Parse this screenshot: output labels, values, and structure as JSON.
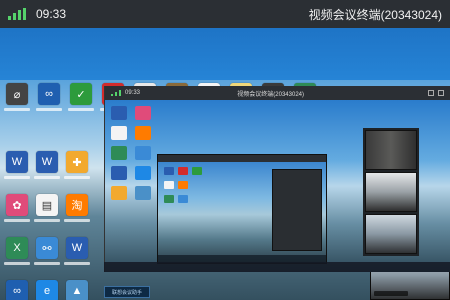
{
  "status_bar": {
    "time": "09:33",
    "title": "视频会议终端(20343024)"
  },
  "nested_window": {
    "time": "09:33",
    "title": "视频会议终端(20343024)"
  },
  "bottom_hint": "联想会议助手"
}
